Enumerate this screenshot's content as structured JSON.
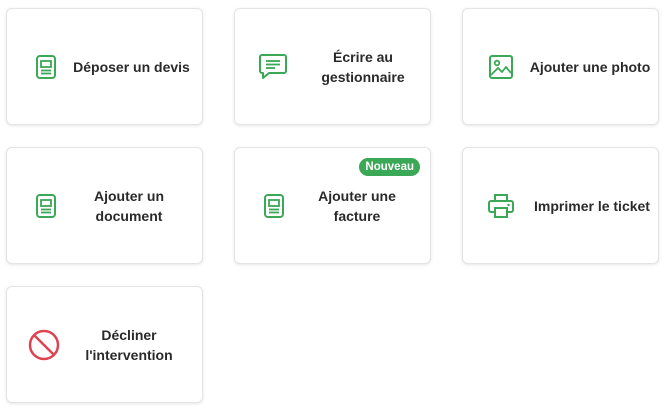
{
  "colors": {
    "icon_green": "#3aa856",
    "icon_red": "#e0424f",
    "badge_bg": "#3aa856",
    "label_text": "#2a2a2a"
  },
  "actions": [
    {
      "id": "deposer-devis",
      "label_line1": "Déposer un devis",
      "label_line2": "",
      "icon": "document-icon"
    },
    {
      "id": "ecrire-gestionnaire",
      "label_line1": "Écrire au",
      "label_line2": "gestionnaire",
      "icon": "message-icon"
    },
    {
      "id": "ajouter-photo",
      "label_line1": "Ajouter une photo",
      "label_line2": "",
      "icon": "image-icon"
    },
    {
      "id": "ajouter-document",
      "label_line1": "Ajouter un",
      "label_line2": "document",
      "icon": "document-icon"
    },
    {
      "id": "ajouter-facture",
      "label_line1": "Ajouter une",
      "label_line2": "facture",
      "icon": "document-icon",
      "badge": "Nouveau"
    },
    {
      "id": "imprimer-ticket",
      "label_line1": "Imprimer le ticket",
      "label_line2": "",
      "icon": "printer-icon"
    },
    {
      "id": "decliner-intervention",
      "label_line1": "Décliner",
      "label_line2": "l'intervention",
      "icon": "prohibited-icon"
    }
  ]
}
